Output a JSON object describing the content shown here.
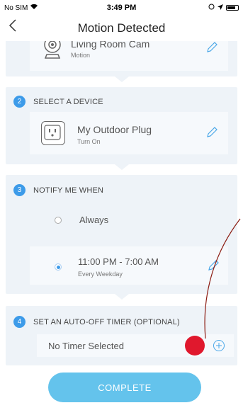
{
  "status_bar": {
    "carrier": "No SIM",
    "time": "3:49 PM"
  },
  "nav": {
    "title": "Motion Detected"
  },
  "trigger": {
    "device_name": "Living Room Cam",
    "device_action": "Motion"
  },
  "steps": [
    {
      "number": "2",
      "label": "SELECT A DEVICE"
    },
    {
      "number": "3",
      "label": "NOTIFY ME WHEN"
    },
    {
      "number": "4",
      "label": "SET AN AUTO-OFF TIMER (OPTIONAL)"
    }
  ],
  "device": {
    "name": "My Outdoor Plug",
    "action": "Turn On"
  },
  "notify": {
    "option_always": "Always",
    "option_schedule_time": "11:00 PM - 7:00 AM",
    "option_schedule_days": "Every Weekday",
    "selected": "schedule"
  },
  "timer": {
    "placeholder_text": "No Timer Selected"
  },
  "complete_button": {
    "label": "COMPLETE"
  },
  "colors": {
    "accent": "#3d9be9",
    "button": "#64c3ec",
    "annotation": "#e0182d",
    "section_bg": "#eef3f8"
  },
  "icons": [
    "wifi-icon",
    "back-chevron-icon",
    "camera-icon",
    "plug-icon",
    "pencil-icon",
    "add-circle-icon"
  ]
}
